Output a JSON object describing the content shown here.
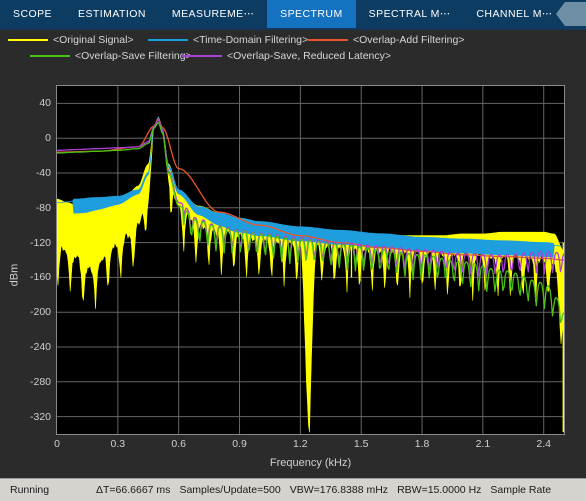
{
  "toolstrip": {
    "tabs": [
      {
        "label": "SCOPE",
        "selected": false,
        "truncated": false
      },
      {
        "label": "ESTIMATION",
        "selected": false,
        "truncated": false
      },
      {
        "label": "MEASUREME",
        "selected": false,
        "truncated": true
      },
      {
        "label": "SPECTRUM",
        "selected": true,
        "truncated": false
      },
      {
        "label": "SPECTRAL M",
        "selected": false,
        "truncated": true
      },
      {
        "label": "CHANNEL M",
        "selected": false,
        "truncated": true
      }
    ],
    "overflow_label": "•••",
    "selected_color": "#1572c0",
    "bar_color": "#0d3c63"
  },
  "legend": {
    "entries": [
      {
        "label": "<Original Signal>",
        "color": "#ffff00"
      },
      {
        "label": "<Time-Domain Filtering>",
        "color": "#1f9ede"
      },
      {
        "label": "<Overlap-Add Filtering>",
        "color": "#e8562a"
      },
      {
        "label": "<Overlap-Save Filtering>",
        "color": "#4ac014"
      },
      {
        "label": "<Overlap-Save,  Reduced Latency>",
        "color": "#a83fd6"
      }
    ]
  },
  "chart_data": {
    "type": "line",
    "title": "",
    "xlabel": "Frequency (kHz)",
    "ylabel": "dBm",
    "xlim": [
      0,
      2.5
    ],
    "ylim": [
      -340,
      60
    ],
    "xticks": [
      0,
      0.3,
      0.6,
      0.9,
      1.2,
      1.5,
      1.8,
      2.1,
      2.4
    ],
    "xtick_labels": [
      "0",
      "0.3",
      "0.6",
      "0.9",
      "1.2",
      "1.5",
      "1.8",
      "2.1",
      "2.4"
    ],
    "yticks": [
      40,
      0,
      -40,
      -80,
      -120,
      -160,
      -200,
      -240,
      -280,
      -320
    ],
    "ytick_labels": [
      "40",
      "0",
      "-40",
      "-80",
      "-120",
      "-160",
      "-200",
      "-240",
      "-280",
      "-320"
    ],
    "grid": true,
    "grid_color": "#666666",
    "background": "#000000",
    "legend_position": "above-plot",
    "series": [
      {
        "name": "<Original Signal>",
        "color": "#ffff00",
        "x": [
          0.0,
          0.05,
          0.1,
          0.15,
          0.2,
          0.25,
          0.3,
          0.35,
          0.4,
          0.45,
          0.48,
          0.5,
          0.52,
          0.55,
          0.6,
          0.7,
          0.8,
          0.9,
          1.0,
          1.1,
          1.2,
          1.24,
          1.28,
          1.4,
          1.5,
          1.6,
          1.7,
          1.8,
          1.9,
          2.0,
          2.1,
          2.2,
          2.3,
          2.4,
          2.45,
          2.5
        ],
        "values": [
          -118,
          -126,
          -133,
          -148,
          -140,
          -126,
          -116,
          -108,
          -95,
          -60,
          15,
          24,
          10,
          -35,
          -75,
          -96,
          -104,
          -108,
          -112,
          -114,
          -116,
          -295,
          -118,
          -120,
          -122,
          -124,
          -126,
          -127,
          -128,
          -129,
          -130,
          -131,
          -132,
          -134,
          -140,
          -200
        ],
        "envelope_top": [
          -70,
          -74,
          -78,
          -84,
          -80,
          -74,
          -70,
          -64,
          -55,
          -30,
          15,
          24,
          10,
          -30,
          -62,
          -78,
          -86,
          -92,
          -96,
          -100,
          -102,
          -104,
          -105,
          -108,
          -110,
          -110,
          -112,
          -112,
          -112,
          -110,
          -110,
          -108,
          -108,
          -108,
          -110,
          -130
        ],
        "note": "broad noisy lobed spectrum with sidelobe nulls; deep null to -295 dBm near 1.24 kHz"
      },
      {
        "name": "<Time-Domain Filtering>",
        "color": "#1f9ede",
        "x": [
          0.0,
          0.1,
          0.2,
          0.3,
          0.4,
          0.45,
          0.48,
          0.5,
          0.52,
          0.55,
          0.6,
          0.7,
          0.8,
          0.9,
          1.0,
          1.2,
          1.4,
          1.6,
          1.8,
          2.0,
          2.2,
          2.4,
          2.5
        ],
        "values": [
          -74,
          -72,
          -70,
          -68,
          -60,
          -40,
          12,
          24,
          11,
          -32,
          -60,
          -80,
          -88,
          -94,
          -98,
          -104,
          -108,
          -112,
          -116,
          -118,
          -120,
          -122,
          -124
        ]
      },
      {
        "name": "<Overlap-Add Filtering>",
        "color": "#e8562a",
        "x": [
          0.0,
          0.2,
          0.4,
          0.48,
          0.5,
          0.52,
          0.6,
          0.8,
          1.0,
          1.2,
          1.4,
          1.6,
          1.8,
          2.0,
          2.2,
          2.4,
          2.5
        ],
        "values": [
          -16,
          -15,
          -10,
          14,
          22,
          12,
          -35,
          -85,
          -100,
          -112,
          -120,
          -126,
          -130,
          -134,
          -136,
          -138,
          -140
        ],
        "note": "hidden beneath overlapping green/magenta traces"
      },
      {
        "name": "<Overlap-Save Filtering>",
        "color": "#4ac014",
        "x": [
          0.0,
          0.1,
          0.2,
          0.3,
          0.4,
          0.45,
          0.48,
          0.5,
          0.52,
          0.55,
          0.6,
          0.7,
          0.8,
          0.9,
          1.0,
          1.2,
          1.4,
          1.6,
          1.8,
          2.0,
          2.2,
          2.4,
          2.48,
          2.5
        ],
        "values": [
          -17,
          -16,
          -15,
          -14,
          -12,
          -6,
          12,
          18,
          6,
          -40,
          -78,
          -95,
          -102,
          -106,
          -110,
          -116,
          -122,
          -128,
          -134,
          -142,
          -152,
          -166,
          -186,
          -200
        ]
      },
      {
        "name": "<Overlap-Save,  Reduced Latency>",
        "color": "#a83fd6",
        "x": [
          0.0,
          0.1,
          0.2,
          0.3,
          0.4,
          0.45,
          0.48,
          0.5,
          0.52,
          0.55,
          0.6,
          0.7,
          0.8,
          0.9,
          1.0,
          1.2,
          1.4,
          1.6,
          1.8,
          2.0,
          2.2,
          2.3,
          2.4,
          2.5
        ],
        "values": [
          -14,
          -13,
          -12,
          -11,
          -10,
          -4,
          14,
          21,
          9,
          -38,
          -74,
          -93,
          -101,
          -105,
          -109,
          -114,
          -120,
          -124,
          -128,
          -132,
          -134,
          -132,
          -130,
          -132
        ]
      }
    ]
  },
  "statusbar": {
    "state": "Running",
    "items": [
      "ΔT=66.6667 ms",
      "Samples/Update=500",
      "VBW=176.8388 mHz",
      "RBW=15.0000 Hz",
      "Sample Rate"
    ]
  }
}
